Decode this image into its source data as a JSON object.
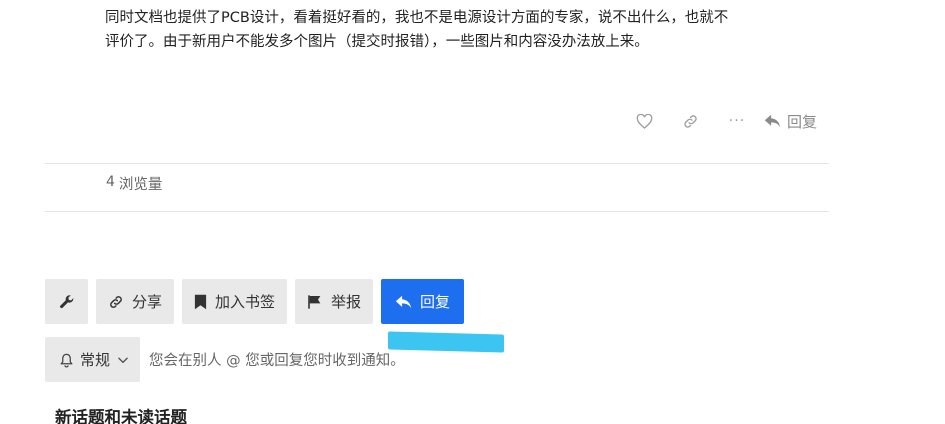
{
  "post": {
    "lines": [
      "同时文档也提供了PCB设计，看着挺好看的，我也不是电源设计方面的专家，说不出什么，也就不",
      "评价了。由于新用户不能发多个图片（提交时报错），一些图片和内容没办法放上来。"
    ],
    "actions": {
      "like_icon": "heart-icon",
      "link_icon": "link-icon",
      "more_label": "···",
      "reply_label": "回复"
    }
  },
  "stats": {
    "views_count": "4",
    "views_label": "浏览量"
  },
  "footer": {
    "admin_icon": "wrench-icon",
    "share_label": "分享",
    "bookmark_label": "加入书签",
    "flag_label": "举报",
    "reply_label": "回复",
    "notification_level": "常规",
    "notification_text": "您会在别人 @ 您或回复您时收到通知。"
  },
  "colors": {
    "primary": "#1e6ef0",
    "button_bg": "#e9e9e9",
    "highlight": "#3cc5f0"
  },
  "section_title": "新话题和未读话题"
}
